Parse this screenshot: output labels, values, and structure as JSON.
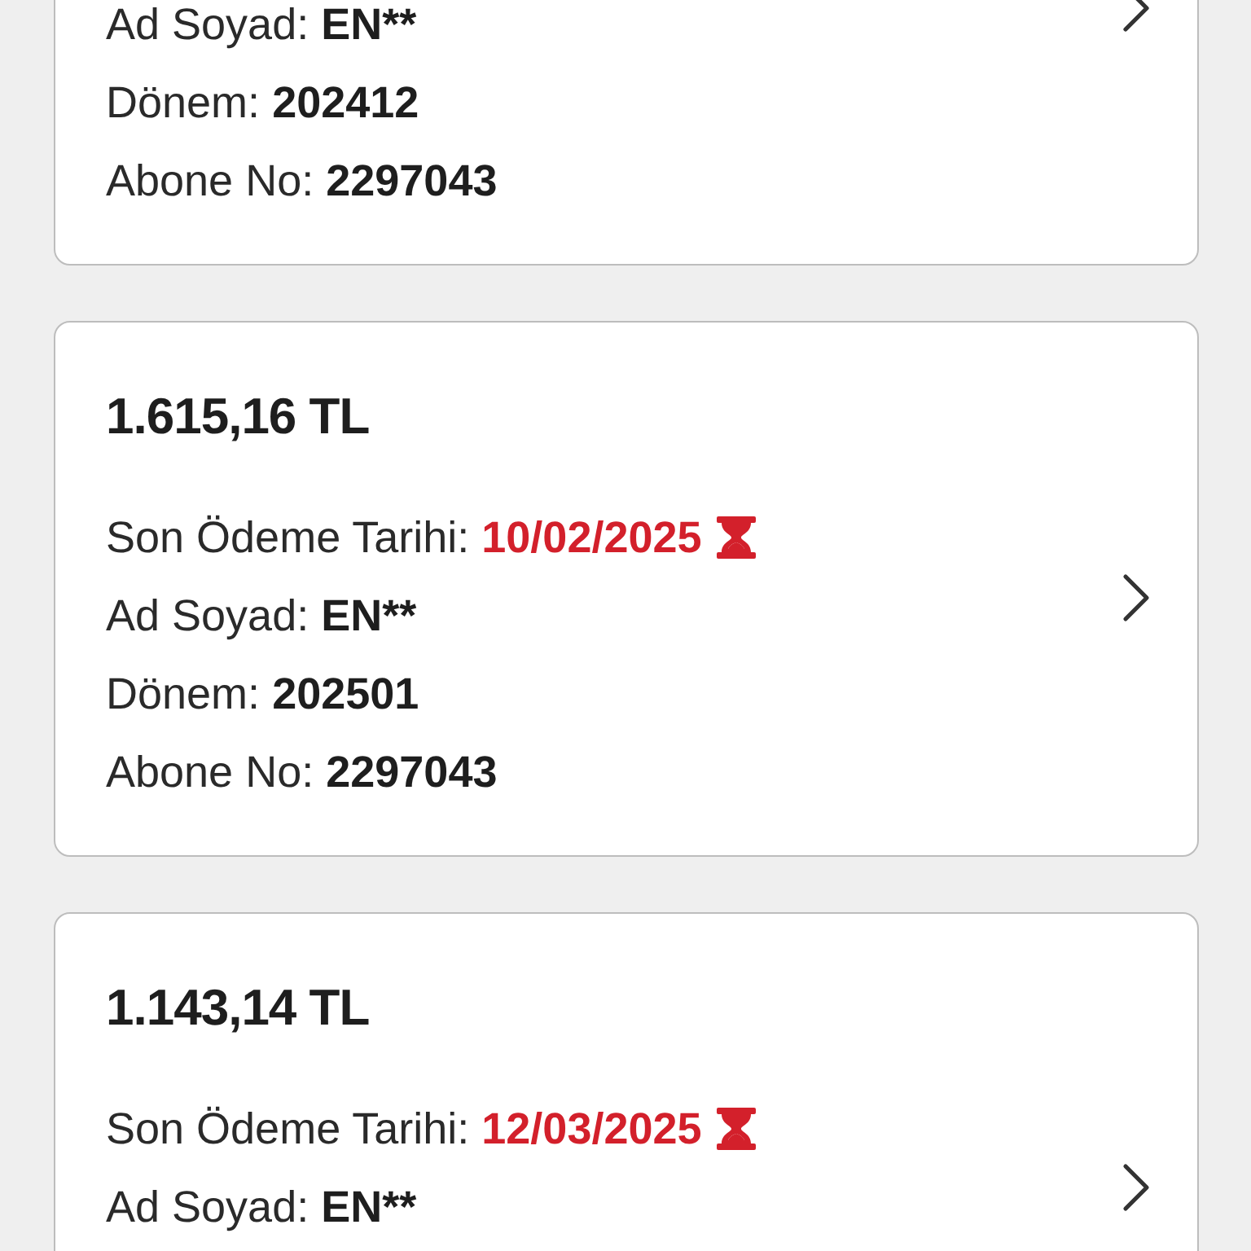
{
  "bills": [
    {
      "rows": [
        {
          "kind": "plain",
          "label": "Ad Soyad:",
          "value": "EN**"
        },
        {
          "kind": "plain",
          "label": "Dönem:",
          "value": "202412"
        },
        {
          "kind": "plain",
          "label": "Abone No:",
          "value": "2297043"
        }
      ]
    },
    {
      "amount": "1.615,16 TL",
      "rows": [
        {
          "kind": "due",
          "label": "Son Ödeme Tarihi:",
          "value": "10/02/2025"
        },
        {
          "kind": "plain",
          "label": "Ad Soyad:",
          "value": "EN**"
        },
        {
          "kind": "plain",
          "label": "Dönem:",
          "value": "202501"
        },
        {
          "kind": "plain",
          "label": "Abone No:",
          "value": "2297043"
        }
      ]
    },
    {
      "amount": "1.143,14 TL",
      "rows": [
        {
          "kind": "due",
          "label": "Son Ödeme Tarihi:",
          "value": "12/03/2025"
        },
        {
          "kind": "plain",
          "label": "Ad Soyad:",
          "value": "EN**"
        }
      ]
    }
  ]
}
